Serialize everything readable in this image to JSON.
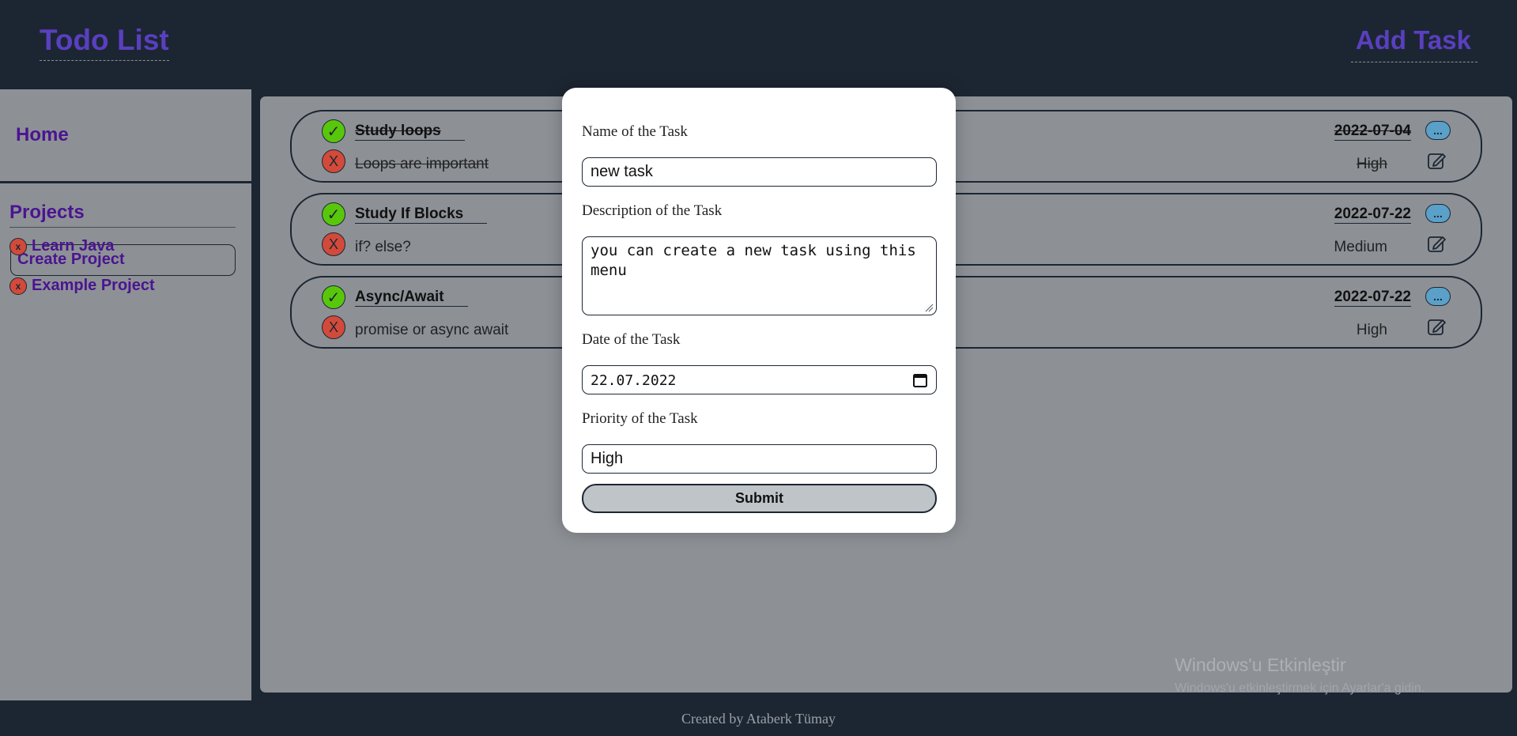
{
  "header": {
    "title": "Todo List",
    "add_task": "Add Task"
  },
  "sidebar": {
    "home": "Home",
    "projects_title": "Projects",
    "create_project": "Create Project",
    "projects": [
      {
        "remove": "x",
        "name": "Learn Java"
      },
      {
        "remove": "x",
        "name": "Example Project"
      }
    ]
  },
  "tasks": [
    {
      "title": "Study loops",
      "description": "Loops are important",
      "date": "2022-07-04",
      "priority": "High",
      "done": true,
      "check": "✓",
      "delete": "X",
      "more": "..."
    },
    {
      "title": "Study If Blocks",
      "description": "if? else?",
      "date": "2022-07-22",
      "priority": "Medium",
      "done": false,
      "check": "✓",
      "delete": "X",
      "more": "..."
    },
    {
      "title": "Async/Await",
      "description": "promise or async await",
      "date": "2022-07-22",
      "priority": "High",
      "done": false,
      "check": "✓",
      "delete": "X",
      "more": "..."
    }
  ],
  "modal": {
    "name_label": "Name of the Task",
    "name_value": "new task",
    "desc_label": "Description of the Task",
    "desc_value": "you can create a new task using this menu",
    "date_label": "Date of the Task",
    "date_value": "22.07.2022",
    "priority_label": "Priority of the Task",
    "priority_value": "High",
    "submit": "Submit"
  },
  "footer": {
    "text": "Created by Ataberk Tümay"
  },
  "watermark": {
    "title": "Windows'u Etkinleştir",
    "subtitle": "Windows'u etkinleştirmek için Ayarlar'a gidin."
  },
  "colors": {
    "accent": "#5a3fc0",
    "sidebar_text": "#4b1490",
    "background": "#1c2632",
    "panel": "#8d9196",
    "check": "#58c70c",
    "delete": "#d24a3a",
    "more": "#5aa0c8"
  }
}
